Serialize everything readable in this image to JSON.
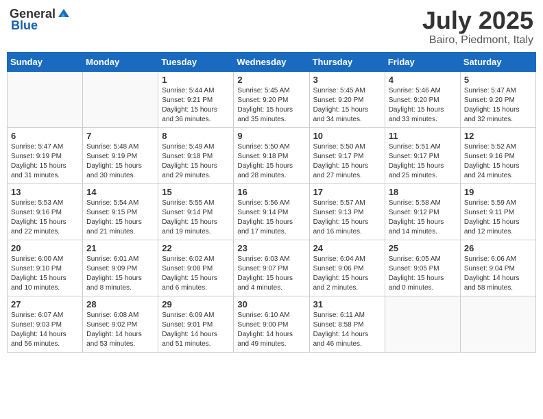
{
  "header": {
    "logo_general": "General",
    "logo_blue": "Blue",
    "month": "July 2025",
    "location": "Bairo, Piedmont, Italy"
  },
  "weekdays": [
    "Sunday",
    "Monday",
    "Tuesday",
    "Wednesday",
    "Thursday",
    "Friday",
    "Saturday"
  ],
  "weeks": [
    [
      {
        "day": "",
        "info": ""
      },
      {
        "day": "",
        "info": ""
      },
      {
        "day": "1",
        "info": "Sunrise: 5:44 AM\nSunset: 9:21 PM\nDaylight: 15 hours\nand 36 minutes."
      },
      {
        "day": "2",
        "info": "Sunrise: 5:45 AM\nSunset: 9:20 PM\nDaylight: 15 hours\nand 35 minutes."
      },
      {
        "day": "3",
        "info": "Sunrise: 5:45 AM\nSunset: 9:20 PM\nDaylight: 15 hours\nand 34 minutes."
      },
      {
        "day": "4",
        "info": "Sunrise: 5:46 AM\nSunset: 9:20 PM\nDaylight: 15 hours\nand 33 minutes."
      },
      {
        "day": "5",
        "info": "Sunrise: 5:47 AM\nSunset: 9:20 PM\nDaylight: 15 hours\nand 32 minutes."
      }
    ],
    [
      {
        "day": "6",
        "info": "Sunrise: 5:47 AM\nSunset: 9:19 PM\nDaylight: 15 hours\nand 31 minutes."
      },
      {
        "day": "7",
        "info": "Sunrise: 5:48 AM\nSunset: 9:19 PM\nDaylight: 15 hours\nand 30 minutes."
      },
      {
        "day": "8",
        "info": "Sunrise: 5:49 AM\nSunset: 9:18 PM\nDaylight: 15 hours\nand 29 minutes."
      },
      {
        "day": "9",
        "info": "Sunrise: 5:50 AM\nSunset: 9:18 PM\nDaylight: 15 hours\nand 28 minutes."
      },
      {
        "day": "10",
        "info": "Sunrise: 5:50 AM\nSunset: 9:17 PM\nDaylight: 15 hours\nand 27 minutes."
      },
      {
        "day": "11",
        "info": "Sunrise: 5:51 AM\nSunset: 9:17 PM\nDaylight: 15 hours\nand 25 minutes."
      },
      {
        "day": "12",
        "info": "Sunrise: 5:52 AM\nSunset: 9:16 PM\nDaylight: 15 hours\nand 24 minutes."
      }
    ],
    [
      {
        "day": "13",
        "info": "Sunrise: 5:53 AM\nSunset: 9:16 PM\nDaylight: 15 hours\nand 22 minutes."
      },
      {
        "day": "14",
        "info": "Sunrise: 5:54 AM\nSunset: 9:15 PM\nDaylight: 15 hours\nand 21 minutes."
      },
      {
        "day": "15",
        "info": "Sunrise: 5:55 AM\nSunset: 9:14 PM\nDaylight: 15 hours\nand 19 minutes."
      },
      {
        "day": "16",
        "info": "Sunrise: 5:56 AM\nSunset: 9:14 PM\nDaylight: 15 hours\nand 17 minutes."
      },
      {
        "day": "17",
        "info": "Sunrise: 5:57 AM\nSunset: 9:13 PM\nDaylight: 15 hours\nand 16 minutes."
      },
      {
        "day": "18",
        "info": "Sunrise: 5:58 AM\nSunset: 9:12 PM\nDaylight: 15 hours\nand 14 minutes."
      },
      {
        "day": "19",
        "info": "Sunrise: 5:59 AM\nSunset: 9:11 PM\nDaylight: 15 hours\nand 12 minutes."
      }
    ],
    [
      {
        "day": "20",
        "info": "Sunrise: 6:00 AM\nSunset: 9:10 PM\nDaylight: 15 hours\nand 10 minutes."
      },
      {
        "day": "21",
        "info": "Sunrise: 6:01 AM\nSunset: 9:09 PM\nDaylight: 15 hours\nand 8 minutes."
      },
      {
        "day": "22",
        "info": "Sunrise: 6:02 AM\nSunset: 9:08 PM\nDaylight: 15 hours\nand 6 minutes."
      },
      {
        "day": "23",
        "info": "Sunrise: 6:03 AM\nSunset: 9:07 PM\nDaylight: 15 hours\nand 4 minutes."
      },
      {
        "day": "24",
        "info": "Sunrise: 6:04 AM\nSunset: 9:06 PM\nDaylight: 15 hours\nand 2 minutes."
      },
      {
        "day": "25",
        "info": "Sunrise: 6:05 AM\nSunset: 9:05 PM\nDaylight: 15 hours\nand 0 minutes."
      },
      {
        "day": "26",
        "info": "Sunrise: 6:06 AM\nSunset: 9:04 PM\nDaylight: 14 hours\nand 58 minutes."
      }
    ],
    [
      {
        "day": "27",
        "info": "Sunrise: 6:07 AM\nSunset: 9:03 PM\nDaylight: 14 hours\nand 56 minutes."
      },
      {
        "day": "28",
        "info": "Sunrise: 6:08 AM\nSunset: 9:02 PM\nDaylight: 14 hours\nand 53 minutes."
      },
      {
        "day": "29",
        "info": "Sunrise: 6:09 AM\nSunset: 9:01 PM\nDaylight: 14 hours\nand 51 minutes."
      },
      {
        "day": "30",
        "info": "Sunrise: 6:10 AM\nSunset: 9:00 PM\nDaylight: 14 hours\nand 49 minutes."
      },
      {
        "day": "31",
        "info": "Sunrise: 6:11 AM\nSunset: 8:58 PM\nDaylight: 14 hours\nand 46 minutes."
      },
      {
        "day": "",
        "info": ""
      },
      {
        "day": "",
        "info": ""
      }
    ]
  ]
}
